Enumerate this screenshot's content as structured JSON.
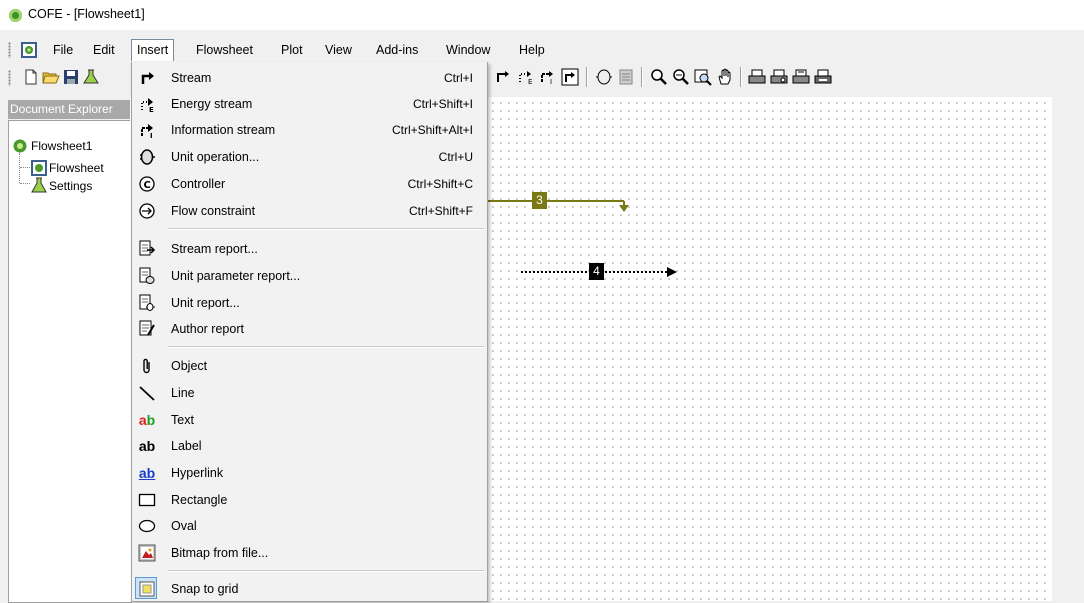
{
  "window": {
    "title": "COFE - [Flowsheet1]"
  },
  "menubar": {
    "items": [
      "File",
      "Edit",
      "Insert",
      "Flowsheet",
      "Plot",
      "View",
      "Add-ins",
      "Window",
      "Help"
    ],
    "active": "Insert"
  },
  "document_explorer": {
    "header": "Document Explorer",
    "tree": {
      "root": "Flowsheet1",
      "children": [
        "Flowsheet",
        "Settings"
      ]
    }
  },
  "insert_menu": {
    "items": [
      {
        "label": "Stream",
        "shortcut": "Ctrl+I",
        "icon": "stream-icon"
      },
      {
        "label": "Energy stream",
        "shortcut": "Ctrl+Shift+I",
        "icon": "energy-stream-icon"
      },
      {
        "label": "Information stream",
        "shortcut": "Ctrl+Shift+Alt+I",
        "icon": "information-stream-icon"
      },
      {
        "label": "Unit operation...",
        "shortcut": "Ctrl+U",
        "icon": "unit-operation-icon"
      },
      {
        "label": "Controller",
        "shortcut": "Ctrl+Shift+C",
        "icon": "controller-icon"
      },
      {
        "label": "Flow constraint",
        "shortcut": "Ctrl+Shift+F",
        "icon": "flow-constraint-icon"
      },
      {
        "label": "Stream report...",
        "shortcut": "",
        "icon": "stream-report-icon"
      },
      {
        "label": "Unit parameter report...",
        "shortcut": "",
        "icon": "unit-parameter-report-icon"
      },
      {
        "label": "Unit report...",
        "shortcut": "",
        "icon": "unit-report-icon"
      },
      {
        "label": "Author report",
        "shortcut": "",
        "icon": "author-report-icon"
      },
      {
        "label": "Object",
        "shortcut": "",
        "icon": "paperclip-icon"
      },
      {
        "label": "Line",
        "shortcut": "",
        "icon": "line-icon"
      },
      {
        "label": "Text",
        "shortcut": "",
        "icon": "text-icon",
        "glyph": "ab"
      },
      {
        "label": "Label",
        "shortcut": "",
        "icon": "label-icon",
        "glyph": "ab"
      },
      {
        "label": "Hyperlink",
        "shortcut": "",
        "icon": "hyperlink-icon",
        "glyph": "ab"
      },
      {
        "label": "Rectangle",
        "shortcut": "",
        "icon": "rectangle-icon"
      },
      {
        "label": "Oval",
        "shortcut": "",
        "icon": "oval-icon"
      },
      {
        "label": "Bitmap from file...",
        "shortcut": "",
        "icon": "bitmap-icon"
      },
      {
        "label": "Snap to grid",
        "shortcut": "",
        "icon": "snap-to-grid-icon"
      }
    ]
  },
  "canvas": {
    "streams": [
      {
        "label": "3",
        "color": "#808000",
        "style": "solid"
      },
      {
        "label": "4",
        "color": "#000000",
        "style": "dotted"
      }
    ]
  },
  "colors": {
    "menu_bg": "#f2f2f2",
    "stream3": "#7a7a14",
    "header_bg": "#a8a8a8"
  }
}
